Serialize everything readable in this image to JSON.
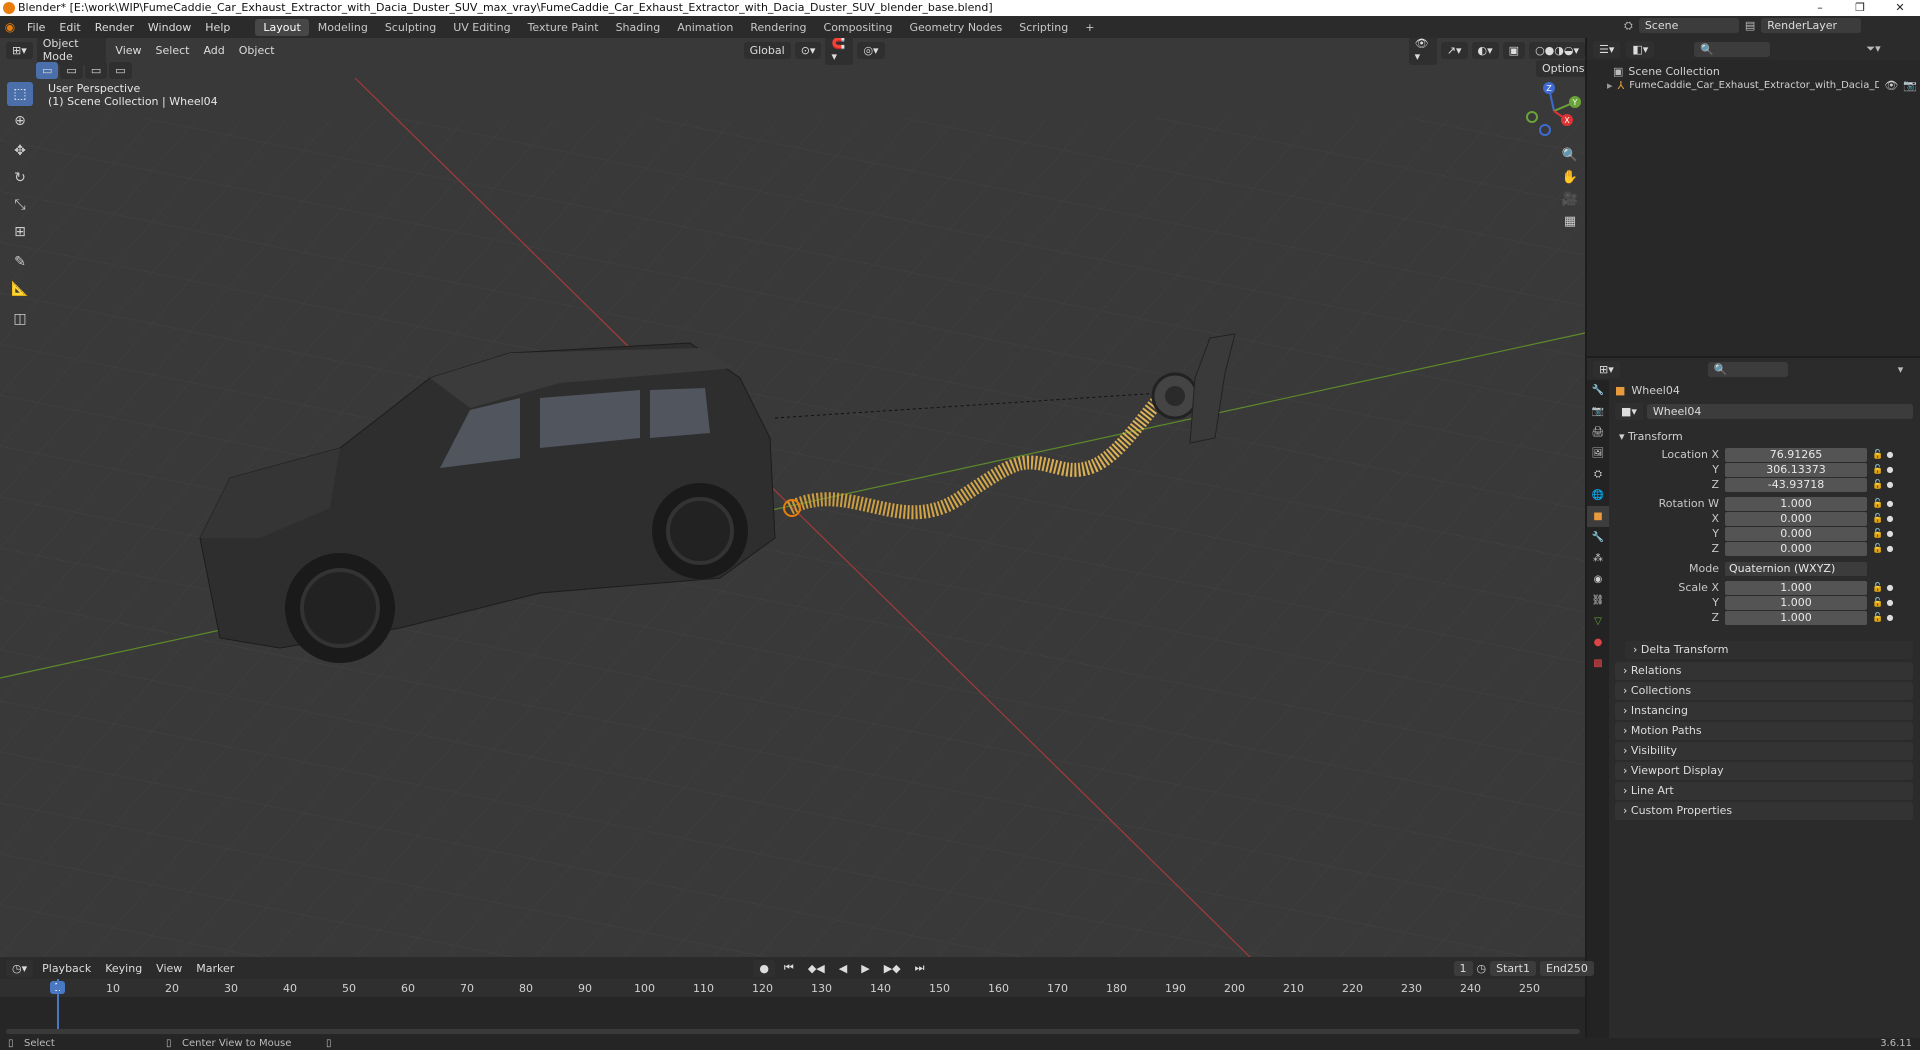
{
  "window": {
    "title": "Blender* [E:\\work\\WIP\\FumeCaddie_Car_Exhaust_Extractor_with_Dacia_Duster_SUV_max_vray\\FumeCaddie_Car_Exhaust_Extractor_with_Dacia_Duster_SUV_blender_base.blend]",
    "controls": [
      "–",
      "❐",
      "✕"
    ]
  },
  "menus": [
    "File",
    "Edit",
    "Render",
    "Window",
    "Help"
  ],
  "workspaces": [
    "Layout",
    "Modeling",
    "Sculpting",
    "UV Editing",
    "Texture Paint",
    "Shading",
    "Animation",
    "Rendering",
    "Compositing",
    "Geometry Nodes",
    "Scripting",
    "+"
  ],
  "active_workspace": "Layout",
  "scene": {
    "label": "Scene",
    "view_layer": "RenderLayer"
  },
  "viewport": {
    "mode": "Object Mode",
    "menus": [
      "View",
      "Select",
      "Add",
      "Object"
    ],
    "orientation": "Global",
    "options": "Options",
    "overlay_title": "User Perspective",
    "overlay_sub": "(1) Scene Collection | Wheel04",
    "gizmo": {
      "x": "X",
      "y": "Y",
      "z": "Z"
    }
  },
  "outliner": {
    "search_placeholder": "",
    "root": "Scene Collection",
    "items": [
      "FumeCaddie_Car_Exhaust_Extractor_with_Dacia_Duster_SUV"
    ]
  },
  "properties": {
    "object_name": "Wheel04",
    "data_name": "Wheel04",
    "transform_label": "Transform",
    "location_label": "Location X",
    "location": {
      "x": "76.91265",
      "y": "306.13373",
      "z": "-43.93718"
    },
    "rotation_label": "Rotation W",
    "rotation": {
      "w": "1.000",
      "x": "0.000",
      "y": "0.000",
      "z": "0.000"
    },
    "mode_label": "Mode",
    "mode_value": "Quaternion (WXYZ)",
    "scale_label": "Scale X",
    "scale": {
      "x": "1.000",
      "y": "1.000",
      "z": "1.000"
    },
    "axis_labels": {
      "x": "X",
      "y": "Y",
      "z": "Z"
    },
    "delta": "Delta Transform",
    "panels": [
      "Relations",
      "Collections",
      "Instancing",
      "Motion Paths",
      "Visibility",
      "Viewport Display",
      "Line Art",
      "Custom Properties"
    ]
  },
  "timeline": {
    "menus": [
      "Playback",
      "Keying",
      "View",
      "Marker"
    ],
    "current_frame": "1",
    "start_label": "Start",
    "start": "1",
    "end_label": "End",
    "end": "250",
    "ruler": [
      "1",
      "10",
      "20",
      "30",
      "40",
      "50",
      "60",
      "70",
      "80",
      "90",
      "100",
      "110",
      "120",
      "130",
      "140",
      "150",
      "160",
      "170",
      "180",
      "190",
      "200",
      "210",
      "220",
      "230",
      "240",
      "250"
    ]
  },
  "statusbar": {
    "left": "Select",
    "middle": "Center View to Mouse",
    "version": "3.6.11"
  }
}
